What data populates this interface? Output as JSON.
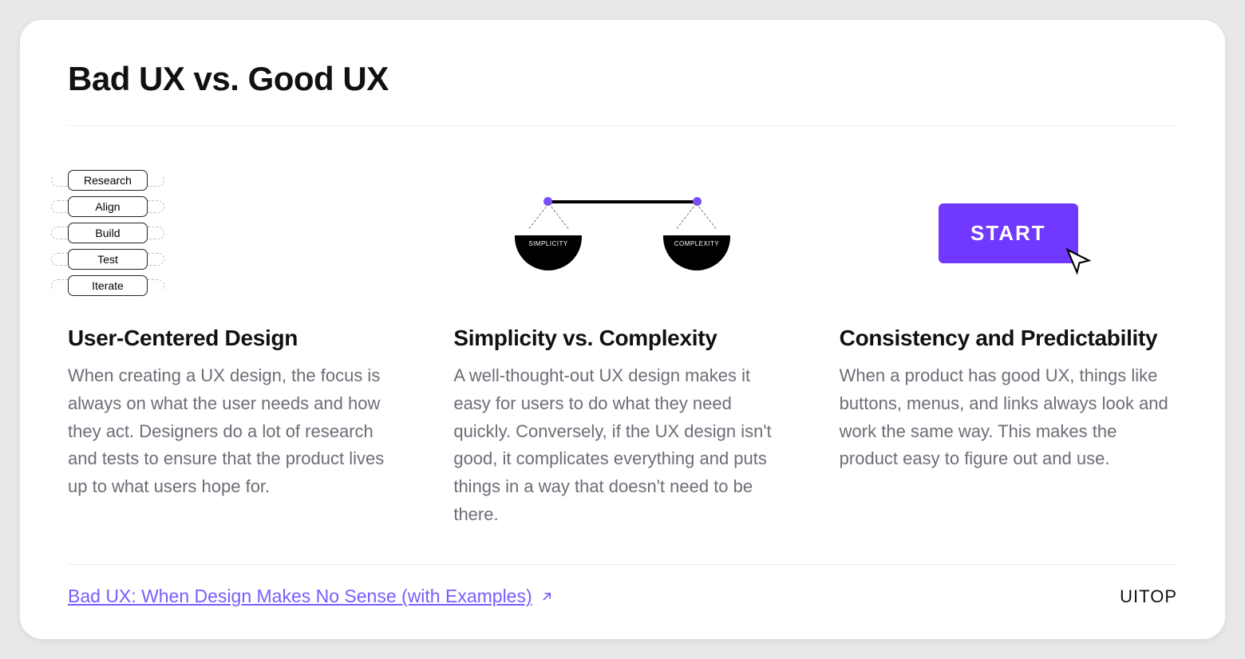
{
  "title": "Bad UX vs. Good UX",
  "columns": [
    {
      "heading": "User-Centered Design",
      "body": "When creating a UX design, the focus is always on what the user needs and how they act. Designers do a lot of research and tests to ensure that the product lives up to what users hope for.",
      "steps": [
        "Research",
        "Align",
        "Build",
        "Test",
        "Iterate"
      ]
    },
    {
      "heading": "Simplicity vs. Complexity",
      "body": "A well-thought-out UX design makes it easy for users to do what they need quickly. Conversely, if the UX design isn't good, it complicates everything and puts things in a way that doesn't need to be there.",
      "left_label": "SIMPLICITY",
      "right_label": "COMPLEXITY"
    },
    {
      "heading": "Consistency and Predictability",
      "body": "When a product has good UX, things like buttons, menus, and links always look and work the same way. This makes the product easy to figure out and use.",
      "button_label": "START"
    }
  ],
  "footer": {
    "link_text": "Bad UX: When Design Makes No Sense (with Examples)",
    "brand": "UITOP"
  },
  "colors": {
    "accent": "#7a5cff",
    "button": "#7138ff"
  }
}
